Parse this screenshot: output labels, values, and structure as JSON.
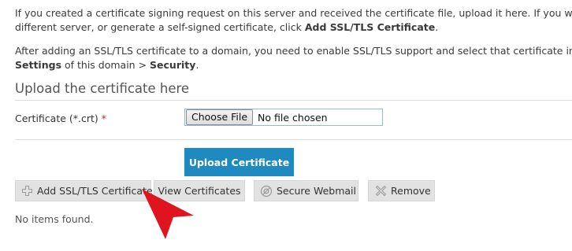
{
  "intro": {
    "p1_line1": "If you created a certificate signing request on this server and received the certificate file, upload it here. If you want to",
    "p1_line2_prefix": "different server, or generate a self-signed certificate, click ",
    "p1_line2_bold": "Add SSL/TLS Certificate",
    "p1_line2_suffix": ".",
    "p2_line1": "After adding an SSL/TLS certificate to a domain, you need to enable SSL/TLS support and select that certificate in the w",
    "p2_line2_bold1": "Settings",
    "p2_line2_middle": " of this domain > ",
    "p2_line2_bold2": "Security",
    "p2_line2_suffix": "."
  },
  "upload_section": {
    "title": "Upload the certificate here",
    "field_label": "Certificate (*.crt)",
    "required_mark": "*",
    "choose_file_label": "Choose File",
    "no_file_text": "No file chosen",
    "upload_button_label": "Upload Certificate"
  },
  "toolbar": {
    "add_label": "Add SSL/TLS Certificate",
    "view_label": "View Certificates",
    "webmail_label": "Secure Webmail",
    "remove_label": "Remove"
  },
  "list": {
    "empty_message": "No items found."
  },
  "colors": {
    "primary_button": "#1f8ac0",
    "toolbar_button_bg": "#e2e2e2",
    "required": "#d02020",
    "annotation_arrow": "#e0141e"
  },
  "icons": {
    "add": "plus-icon",
    "webmail": "webmail-icon",
    "remove": "remove-icon",
    "annotation": "red-arrow-pointer"
  }
}
